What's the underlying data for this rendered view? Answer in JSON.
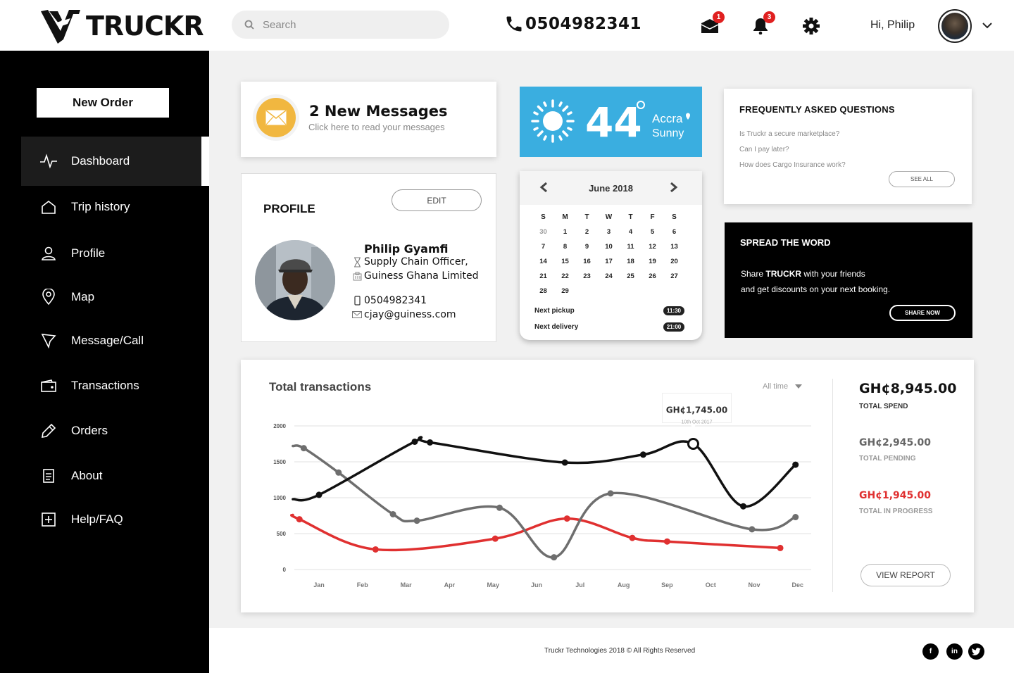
{
  "header": {
    "brand": "TRUCKR",
    "search_placeholder": "Search",
    "phone": "0504982341",
    "mail_count": "1",
    "notification_count": "3",
    "greeting": "Hi, Philip"
  },
  "sidebar": {
    "new_order_label": "New Order",
    "items": [
      {
        "label": "Dashboard",
        "icon": "pulse-icon"
      },
      {
        "label": "Trip history",
        "icon": "home-icon"
      },
      {
        "label": "Profile",
        "icon": "user-icon"
      },
      {
        "label": "Map",
        "icon": "map-pin-icon"
      },
      {
        "label": "Message/Call",
        "icon": "cursor-icon"
      },
      {
        "label": "Transactions",
        "icon": "wallet-icon"
      },
      {
        "label": "Orders",
        "icon": "pencil-icon"
      },
      {
        "label": "About",
        "icon": "document-icon"
      },
      {
        "label": "Help/FAQ",
        "icon": "plus-square-icon"
      }
    ],
    "active": "Dashboard"
  },
  "messages": {
    "title": "2 New Messages",
    "subtitle": "Click here to read your messages"
  },
  "weather": {
    "temperature": "44",
    "city": "Accra",
    "condition": "Sunny",
    "color": "#3aaee0"
  },
  "faq": {
    "title": "FREQUENTLY ASKED QUESTIONS",
    "questions": [
      "Is Truckr a secure marketplace?",
      "Can I pay later?",
      "How does Cargo Insurance work?"
    ],
    "see_all": "SEE ALL"
  },
  "profile": {
    "title": "PROFILE",
    "edit_label": "EDIT",
    "name": "Philip Gyamfi",
    "role": "Supply Chain Officer,",
    "company": "Guiness Ghana Limited",
    "phone": "0504982341",
    "email": "cjay@guiness.com"
  },
  "calendar": {
    "month": "June 2018",
    "weekdays": [
      "S",
      "M",
      "T",
      "W",
      "T",
      "F",
      "S"
    ],
    "weeks": [
      [
        "30",
        "1",
        "2",
        "3",
        "4",
        "5",
        "6"
      ],
      [
        "7",
        "8",
        "9",
        "10",
        "11",
        "12",
        "13"
      ],
      [
        "14",
        "15",
        "16",
        "17",
        "18",
        "19",
        "20"
      ],
      [
        "21",
        "22",
        "23",
        "24",
        "25",
        "26",
        "27"
      ],
      [
        "28",
        "29",
        "",
        "",
        "",
        "",
        ""
      ]
    ],
    "next_pickup_label": "Next pickup",
    "next_pickup_time": "11:30",
    "next_delivery_label": "Next delivery",
    "next_delivery_time": "21:00"
  },
  "spread": {
    "title": "SPREAD THE WORD",
    "line1_prefix": "Share ",
    "line1_brand": "TRUCKR",
    "line1_suffix": " with your friends",
    "line2": "and get discounts on your next booking.",
    "share_label": "SHARE NOW"
  },
  "transactions": {
    "title": "Total transactions",
    "range": "All time",
    "total_spend": "GH¢8,945.00",
    "total_spend_label": "TOTAL SPEND",
    "total_pending": "GH¢2,945.00",
    "total_pending_label": "TOTAL PENDING",
    "total_progress": "GH¢1,945.00",
    "total_progress_label": "TOTAL IN PROGRESS",
    "progress_color": "#e03030",
    "view_report": "VIEW REPORT",
    "tooltip_value": "GH¢1,745.00",
    "tooltip_date": "10th Oct 2017"
  },
  "chart_data": {
    "type": "line",
    "categories": [
      "Jan",
      "Feb",
      "Mar",
      "Apr",
      "May",
      "Jun",
      "Jul",
      "Aug",
      "Sep",
      "Oct",
      "Nov",
      "Dec"
    ],
    "ylim": [
      0,
      2000
    ],
    "y_ticks": [
      0,
      500,
      1000,
      1500,
      2000
    ],
    "grid": true,
    "series": [
      {
        "color": "#111111",
        "points": [
          [
            -0.6,
            980
          ],
          [
            0.0,
            1040
          ],
          [
            2.2,
            1780
          ],
          [
            2.55,
            1770
          ],
          [
            5.65,
            1490
          ],
          [
            7.45,
            1600
          ],
          [
            8.6,
            1750
          ],
          [
            9.75,
            880
          ],
          [
            10.95,
            1460
          ]
        ],
        "highlight_index": 6
      },
      {
        "color": "#6e6e6e",
        "points": [
          [
            -0.6,
            1720
          ],
          [
            -0.35,
            1690
          ],
          [
            0.45,
            1350
          ],
          [
            1.7,
            770
          ],
          [
            2.25,
            680
          ],
          [
            4.15,
            860
          ],
          [
            5.4,
            170
          ],
          [
            6.7,
            1060
          ],
          [
            9.95,
            560
          ],
          [
            10.95,
            730
          ]
        ]
      },
      {
        "color": "#e03030",
        "points": [
          [
            -0.6,
            760
          ],
          [
            -0.45,
            700
          ],
          [
            1.3,
            280
          ],
          [
            4.05,
            430
          ],
          [
            5.7,
            710
          ],
          [
            7.2,
            440
          ],
          [
            8.0,
            390
          ],
          [
            10.6,
            300
          ]
        ]
      }
    ]
  }
}
